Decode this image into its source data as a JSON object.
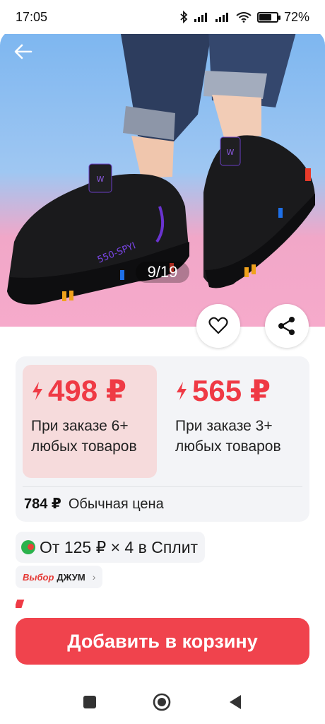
{
  "status_bar": {
    "time": "17:05",
    "battery_percent": "72",
    "battery_level": 0.72,
    "icons": [
      "bluetooth-icon",
      "signal-icon",
      "signal-icon",
      "wifi-icon",
      "battery-icon"
    ]
  },
  "gallery": {
    "counter": "9/19",
    "current": 9,
    "total": 19,
    "shoe_text": "550-SPYI"
  },
  "actions": {
    "favorite_icon": "heart-icon",
    "share_icon": "share-icon",
    "back_icon": "arrow-left-icon"
  },
  "prices": {
    "tiers": [
      {
        "price": "498 ₽",
        "condition": "При заказе 6+ любых товаров"
      },
      {
        "price": "565 ₽",
        "condition": "При заказе 3+ любых товаров"
      }
    ],
    "regular_price": "784 ₽",
    "regular_label": "Обычная цена"
  },
  "split": {
    "text": "От 125 ₽ × 4 в Сплит"
  },
  "brand_badge": {
    "part1": "Выбор",
    "part2": "ДЖУМ",
    "chevron": "›"
  },
  "cta": {
    "add_to_cart": "Добавить в корзину"
  },
  "colors": {
    "accent": "#f0434d",
    "price_red": "#ef3a45",
    "card_bg": "#f3f4f7",
    "tier_highlight": "#f6dbdc"
  }
}
